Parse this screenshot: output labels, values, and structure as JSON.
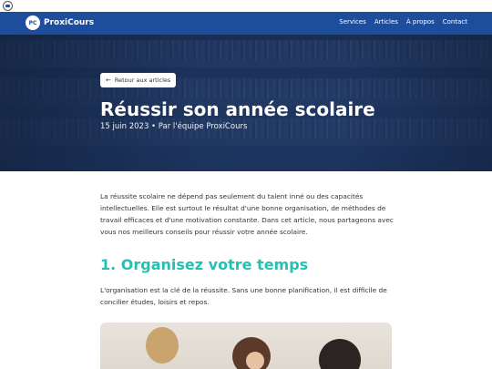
{
  "brand": {
    "badge": "PC",
    "name": "ProxiCours"
  },
  "nav": {
    "items": [
      "Services",
      "Articles",
      "À propos",
      "Contact"
    ]
  },
  "hero": {
    "back_label": "Retour aux articles",
    "title": "Réussir son année scolaire",
    "meta": "15 juin 2023 • Par l'équipe ProxiCours"
  },
  "article": {
    "intro": "La réussite scolaire ne dépend pas seulement du talent inné ou des capacités intellectuelles. Elle est surtout le résultat d'une bonne organisation, de méthodes de travail efficaces et d'une motivation constante. Dans cet article, nous partageons avec vous nos meilleurs conseils pour réussir votre année scolaire.",
    "section1_title": "1. Organisez votre temps",
    "section1_text": "L'organisation est la clé de la réussite. Sans une bonne planification, il est difficile de concilier études, loisirs et repos."
  },
  "colors": {
    "nav_bg": "#1d4e9e",
    "heading_accent": "#26c0b3"
  }
}
